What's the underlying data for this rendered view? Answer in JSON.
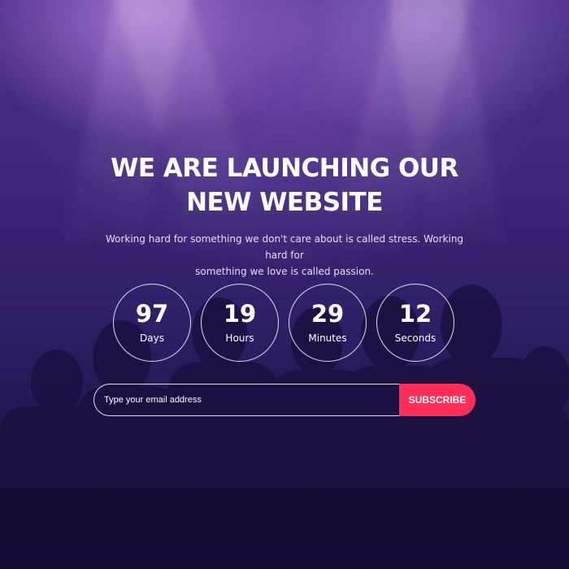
{
  "hero": {
    "title_line1": "WE ARE LAUNCHING OUR",
    "title_line2": "NEW WEBSITE",
    "subtitle_line1": "Working hard for something we don't care about is called stress. Working hard for",
    "subtitle_line2": "something we love is called passion."
  },
  "countdown": [
    {
      "value": "97",
      "label": "Days"
    },
    {
      "value": "19",
      "label": "Hours"
    },
    {
      "value": "29",
      "label": "Minutes"
    },
    {
      "value": "12",
      "label": "Seconds"
    }
  ],
  "subscribe": {
    "placeholder": "Type your email address",
    "button_label": "SUBSCRIBE"
  },
  "colors": {
    "accent": "#ff2d58",
    "background_top": "#4a2f86",
    "background_bottom": "#180d3a"
  }
}
